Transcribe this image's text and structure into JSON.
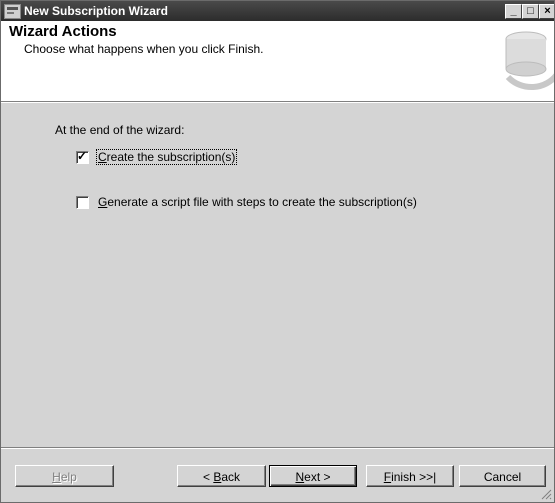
{
  "window": {
    "title": "New Subscription Wizard",
    "controls": {
      "minimize": "_",
      "maximize": "□",
      "close": "×"
    }
  },
  "header": {
    "title": "Wizard Actions",
    "subtitle": "Choose what happens when you click Finish."
  },
  "body": {
    "label": "At the end of the wizard:",
    "options": [
      {
        "pre": "",
        "mnemonic": "C",
        "post": "reate the subscription(s)",
        "checked": true
      },
      {
        "pre": "",
        "mnemonic": "G",
        "post": "enerate a script file with steps to create the subscription(s)",
        "checked": false
      }
    ]
  },
  "buttons": {
    "help": {
      "pre": "",
      "mnemonic": "H",
      "post": "elp"
    },
    "back": {
      "pre": "< ",
      "mnemonic": "B",
      "post": "ack"
    },
    "next": {
      "pre": "",
      "mnemonic": "N",
      "post": "ext >"
    },
    "finish": {
      "pre": "",
      "mnemonic": "F",
      "post": "inish >>|"
    },
    "cancel": "Cancel"
  },
  "icons": {
    "check": "✓",
    "app": "wizard-app-icon",
    "logo": "database-logo-icon"
  }
}
